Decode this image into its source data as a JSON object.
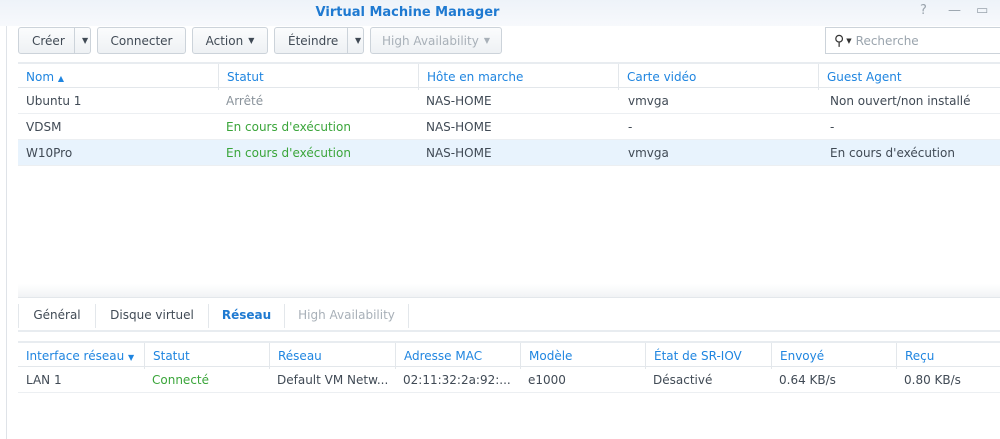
{
  "window": {
    "title": "Virtual Machine Manager",
    "help": "?",
    "minimize": "—",
    "maximize": "▭"
  },
  "toolbar": {
    "create": "Créer",
    "connect": "Connecter",
    "action": "Action",
    "shutdown": "Éteindre",
    "ha": "High Availability",
    "search_placeholder": "Recherche"
  },
  "vm_table": {
    "headers": [
      "Nom",
      "Statut",
      "Hôte en marche",
      "Carte vidéo",
      "Guest Agent"
    ],
    "rows": [
      [
        "Ubuntu 1",
        "Arrêté",
        "NAS-HOME",
        "vmvga",
        "Non ouvert/non installé"
      ],
      [
        "VDSM",
        "En cours d'exécution",
        "NAS-HOME",
        "-",
        "-"
      ],
      [
        "W10Pro",
        "En cours d'exécution",
        "NAS-HOME",
        "vmvga",
        "En cours d'exécution"
      ]
    ]
  },
  "tabs": [
    "Général",
    "Disque virtuel",
    "Réseau",
    "High Availability"
  ],
  "net_table": {
    "headers": [
      "Interface réseau",
      "Statut",
      "Réseau",
      "Adresse MAC",
      "Modèle",
      "État de SR-IOV",
      "Envoyé",
      "Reçu"
    ],
    "rows": [
      [
        "LAN 1",
        "Connecté",
        "Default VM Netw...",
        "02:11:32:2a:92:...",
        "e1000",
        "Désactivé",
        "0.64 KB/s",
        "0.80 KB/s"
      ]
    ]
  }
}
